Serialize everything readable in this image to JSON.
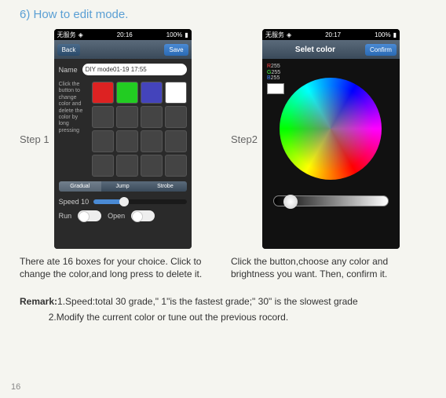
{
  "title": "6) How to edit mode.",
  "step1": {
    "label": "Step 1",
    "status": {
      "carrier": "无服务",
      "time": "20:16",
      "battery": "100%"
    },
    "nav": {
      "back": "Back",
      "save": "Save"
    },
    "name_label": "Name",
    "name_value": "DIY mode01-19 17:55",
    "hint": "Click the button to change color and delete the color by long pressing",
    "grid_colors": [
      "#d22",
      "#2c2",
      "#44b",
      "#fff"
    ],
    "tabs": [
      "Gradual",
      "Jump",
      "Strobe"
    ],
    "speed_label": "Speed 10",
    "run_label": "Run",
    "open_label": "Open",
    "caption": "There ate 16 boxes for your choice. Click to change the color,and long press to delete it."
  },
  "step2": {
    "label": "Step2",
    "status": {
      "carrier": "无服务",
      "time": "20:17",
      "battery": "100%"
    },
    "nav": {
      "title": "Selet color",
      "confirm": "Confirm"
    },
    "rgb": {
      "r": "255",
      "g": "255",
      "b": "255"
    },
    "caption": "Click the button,choose any color and brightness you want. Then, confirm it."
  },
  "remark": {
    "label": "Remark:",
    "line1": "1.Speed:total 30 grade,\" 1\"is the fastest grade;\" 30\" is the slowest grade",
    "line2": "2.Modify the current color or tune out the previous rocord."
  },
  "page": "16"
}
